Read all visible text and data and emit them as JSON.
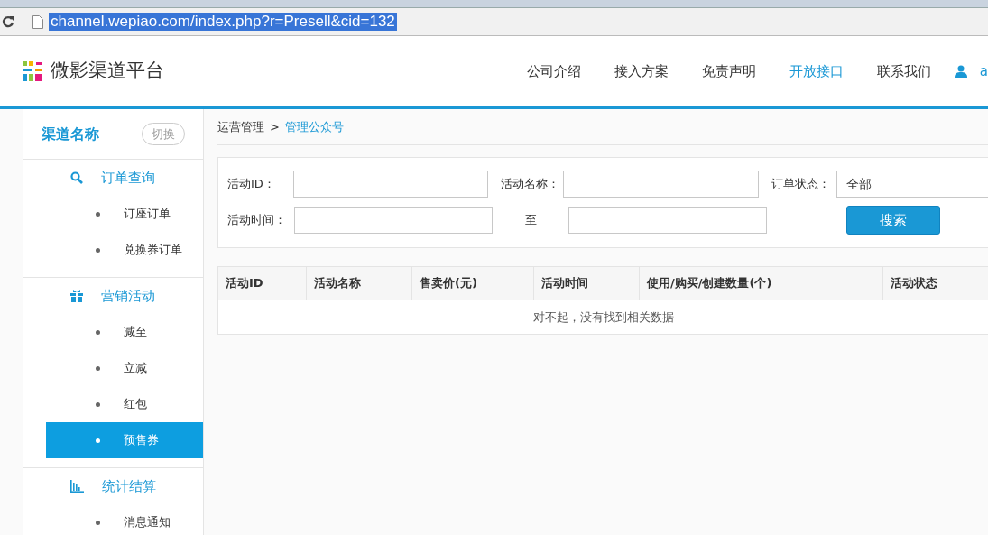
{
  "browser": {
    "url": "channel.wepiao.com/index.php?r=Presell&cid=132",
    "url_selected": true
  },
  "header": {
    "logo_text": "微影渠道平台",
    "nav": [
      {
        "label": "公司介绍",
        "selected": false
      },
      {
        "label": "接入方案",
        "selected": false
      },
      {
        "label": "免责声明",
        "selected": false
      },
      {
        "label": "开放接口",
        "selected": true
      },
      {
        "label": "联系我们",
        "selected": false
      }
    ],
    "user": "a"
  },
  "sidebar": {
    "title": "渠道名称",
    "switch_button": "切换",
    "groups": [
      {
        "kind": "search",
        "label": "订单查询",
        "items": [
          {
            "label": "订座订单",
            "selected": false
          },
          {
            "label": "兑换券订单",
            "selected": false
          }
        ]
      },
      {
        "kind": "gift",
        "label": "营销活动",
        "items": [
          {
            "label": "减至",
            "selected": false
          },
          {
            "label": "立减",
            "selected": false
          },
          {
            "label": "红包",
            "selected": false
          },
          {
            "label": "预售券",
            "selected": true
          }
        ]
      },
      {
        "kind": "chart",
        "label": "统计结算",
        "items": [
          {
            "label": "消息通知",
            "selected": false
          }
        ]
      }
    ]
  },
  "breadcrumb": [
    {
      "label": "运营管理",
      "link": false
    },
    {
      "label": "管理公众号",
      "link": true
    }
  ],
  "breadcrumb_separator": ">",
  "filters": {
    "activity_id_label": "活动ID：",
    "activity_name_label": "活动名称：",
    "order_status_label": "订单状态：",
    "order_status_value": "全部",
    "activity_time_label": "活动时间：",
    "to_label": "至",
    "search_button": "搜索"
  },
  "table": {
    "columns": [
      "活动ID",
      "活动名称",
      "售卖价(元)",
      "活动时间",
      "使用/购买/创建数量(个)",
      "活动状态"
    ],
    "empty_message": "对不起，没有找到相关数据"
  }
}
